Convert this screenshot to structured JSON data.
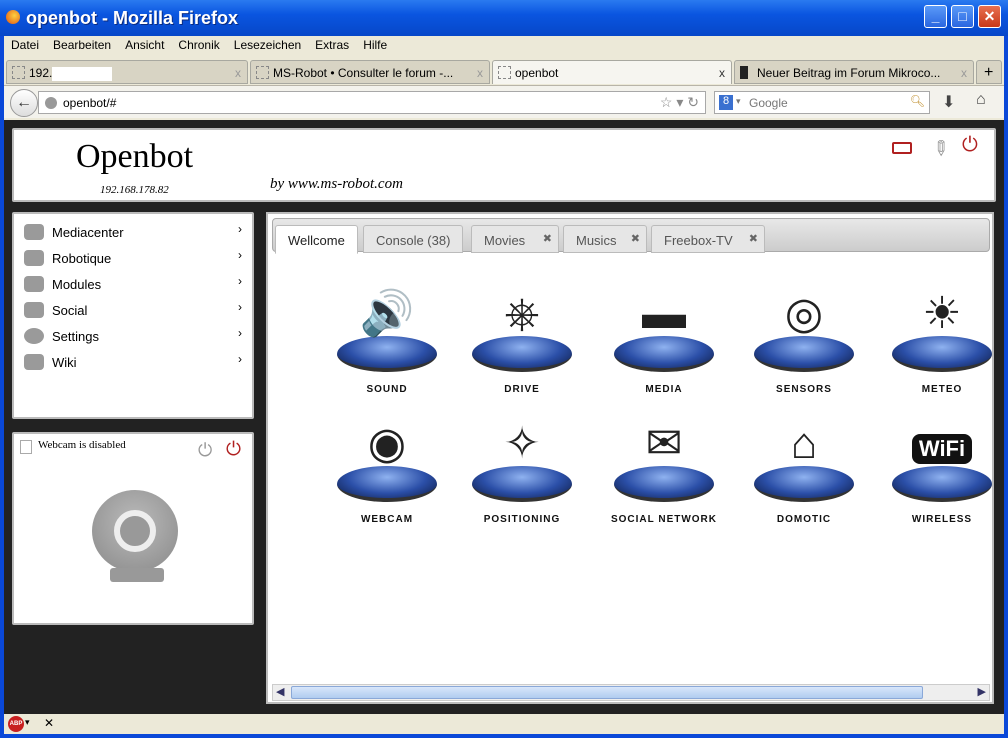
{
  "window": {
    "title": "openbot - Mozilla Firefox"
  },
  "menu": [
    "Datei",
    "Bearbeiten",
    "Ansicht",
    "Chronik",
    "Lesezeichen",
    "Extras",
    "Hilfe"
  ],
  "browser_tabs": [
    {
      "label": "192."
    },
    {
      "label": "MS-Robot • Consulter le forum -..."
    },
    {
      "label": "openbot"
    },
    {
      "label": "Neuer Beitrag im Forum Mikroco..."
    }
  ],
  "address": "openbot/#",
  "search_placeholder": "Google",
  "header": {
    "title": "Openbot",
    "ip": "192.168.178.82",
    "byline": "by www.ms-robot.com"
  },
  "sidebar": [
    "Mediacenter",
    "Robotique",
    "Modules",
    "Social",
    "Settings",
    "Wiki"
  ],
  "webcam": {
    "status": "Webcam is disabled"
  },
  "tabs": [
    {
      "label": "Wellcome",
      "closable": false
    },
    {
      "label": "Console (38)",
      "closable": false
    },
    {
      "label": "Movies",
      "closable": true
    },
    {
      "label": "Musics",
      "closable": true
    },
    {
      "label": "Freebox-TV",
      "closable": true
    }
  ],
  "apps": [
    "Sound",
    "Drive",
    "Media",
    "Sensors",
    "Meteo",
    "Webcam",
    "Positioning",
    "Social Network",
    "Domotic",
    "Wireless"
  ],
  "colors": {
    "accent": "#2b4fa8",
    "power": "#b02020"
  }
}
